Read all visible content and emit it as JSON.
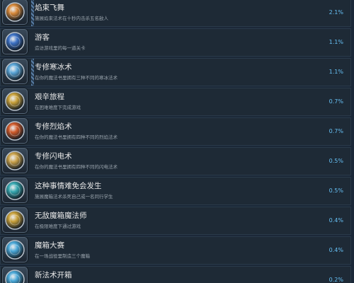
{
  "achievements": [
    {
      "title": "焰束飞舞",
      "desc": "施展焰束法术在十秒内击杀五名敌人",
      "percent": "2.1%",
      "icon": "fire-comet-icon",
      "color": "#d8893a",
      "stripe": true
    },
    {
      "title": "游客",
      "desc": "造访游戏里的每一道关卡",
      "percent": "1.1%",
      "icon": "blue-orb-icon",
      "color": "#3d72c6",
      "stripe": false
    },
    {
      "title": "专修寒冰术",
      "desc": "在你的魔法书里拥有三种不同的寒冰法术",
      "percent": "1.1%",
      "icon": "snowflake-icon",
      "color": "#5aa6d8",
      "stripe": true
    },
    {
      "title": "艰辛旅程",
      "desc": "在困难难度下完成游戏",
      "percent": "0.7%",
      "icon": "gold-badge-icon",
      "color": "#c9a13a",
      "stripe": false
    },
    {
      "title": "专修烈焰术",
      "desc": "在你的魔法书里拥有四种不同的烈焰法术",
      "percent": "0.7%",
      "icon": "fire-spell-icon",
      "color": "#d05a2a",
      "stripe": false
    },
    {
      "title": "专修闪电术",
      "desc": "在你的魔法书里拥有四种不同的闪电法术",
      "percent": "0.5%",
      "icon": "lightning-scroll-icon",
      "color": "#caa24a",
      "stripe": false
    },
    {
      "title": "这种事情难免会发生",
      "desc": "施展魔箱法术杀死自己或一名同行学生",
      "percent": "0.5%",
      "icon": "teal-orb-icon",
      "color": "#36a8b0",
      "stripe": false
    },
    {
      "title": "无敌魔箱魔法师",
      "desc": "在极限难度下通过游戏",
      "percent": "0.4%",
      "icon": "gold-badge-icon",
      "color": "#c9a13a",
      "stripe": false
    },
    {
      "title": "魔箱大赛",
      "desc": "在一场战役里制造三个魔箱",
      "percent": "0.4%",
      "icon": "crystal-orb-icon",
      "color": "#4aa8d8",
      "stripe": false
    },
    {
      "title": "新法术开箱",
      "desc": "",
      "percent": "0.2%",
      "icon": "crystal-orb-icon",
      "color": "#4aa8d8",
      "stripe": false
    }
  ]
}
